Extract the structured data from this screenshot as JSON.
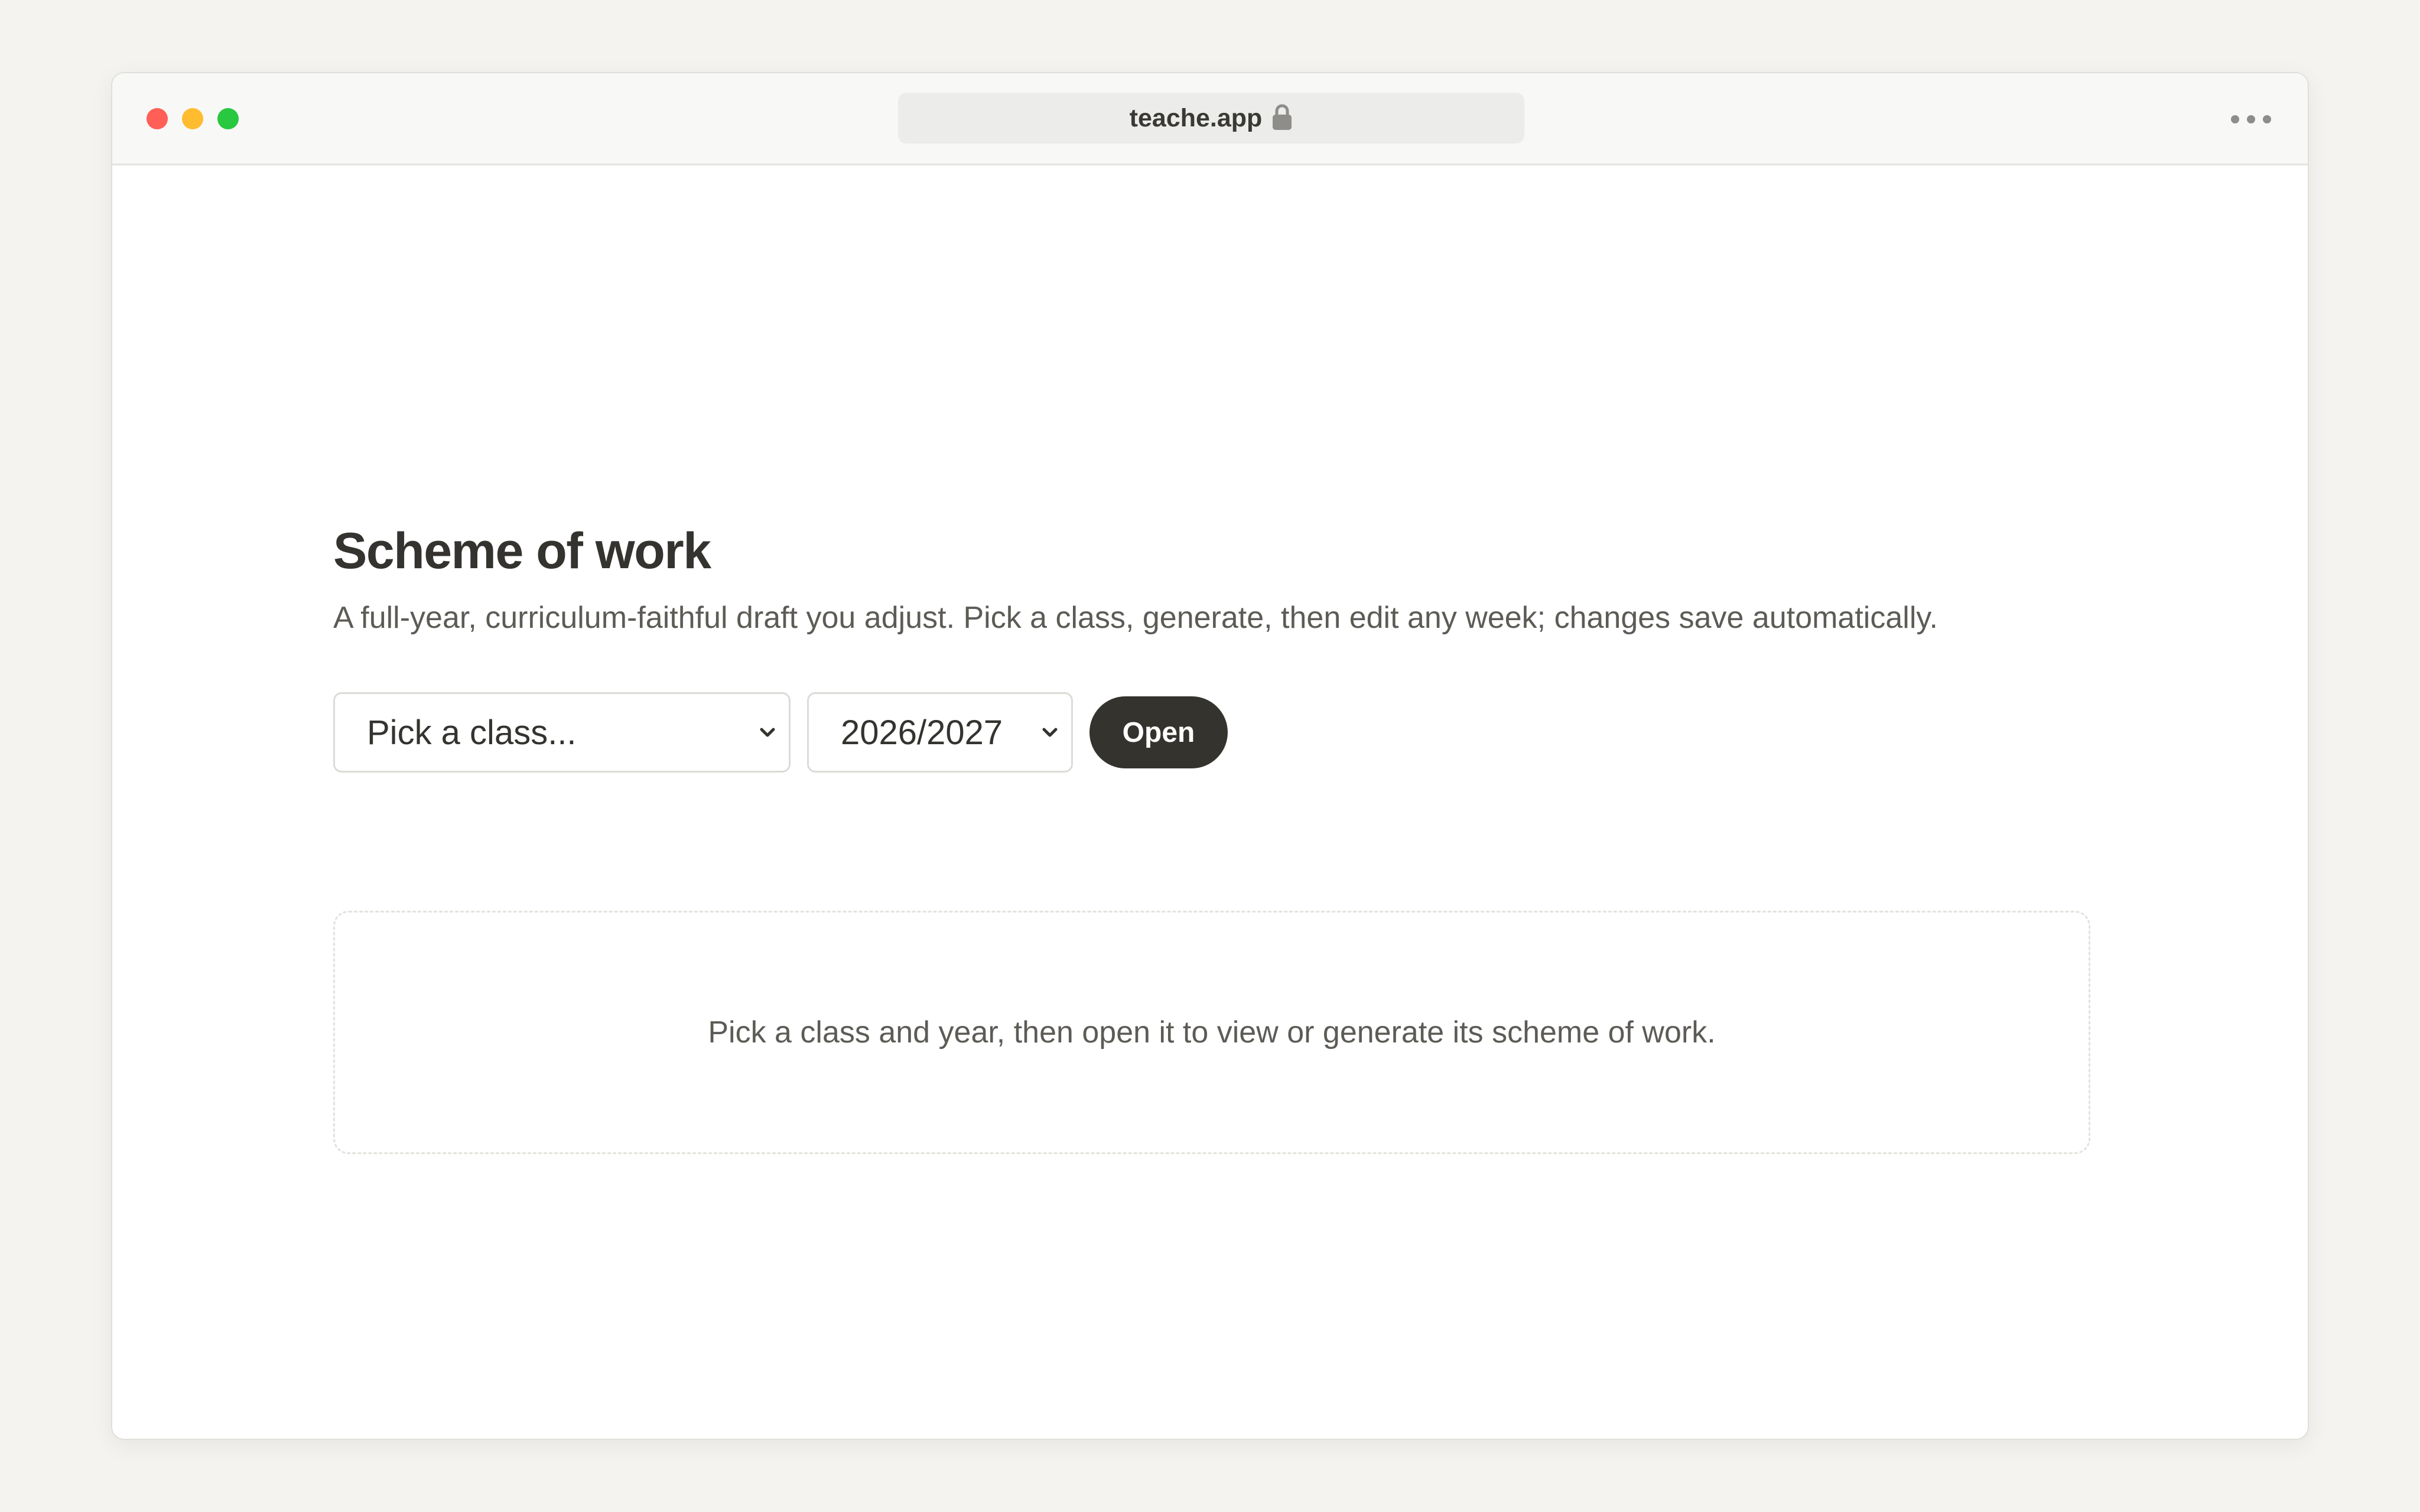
{
  "browser": {
    "url": "teache.app",
    "url_icon": "lock-icon",
    "menu_icon": "more-horizontal-icon",
    "traffic_colors": {
      "close": "#ff5f57",
      "minimize": "#febc2e",
      "maximize": "#28c840"
    }
  },
  "page": {
    "title": "Scheme of work",
    "subtitle": "A full-year, curriculum-faithful draft you adjust. Pick a class, generate, then edit any week; changes save automatically."
  },
  "controls": {
    "class_select": {
      "value": "Pick a class...",
      "icon": "chevron-down-icon"
    },
    "year_select": {
      "value": "2026/2027",
      "icon": "chevron-down-icon"
    },
    "open_label": "Open",
    "open_color": "#34332e"
  },
  "empty_state": {
    "message": "Pick a class and year, then open it to view or generate its scheme of work."
  }
}
